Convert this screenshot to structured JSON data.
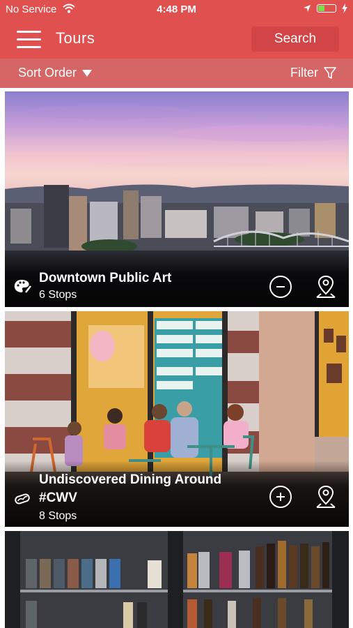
{
  "status": {
    "carrier": "No Service",
    "time": "4:48 PM"
  },
  "nav": {
    "title": "Tours",
    "search_label": "Search"
  },
  "filterbar": {
    "sort_label": "Sort Order",
    "filter_label": "Filter"
  },
  "tours": [
    {
      "title": "Downtown Public Art",
      "stops": "6 Stops",
      "icon": "palette-icon",
      "action": "remove"
    },
    {
      "title_line1": "Undiscovered Dining Around",
      "title_line2": "#CWV",
      "stops": "8 Stops",
      "icon": "hotdog-icon",
      "action": "add"
    },
    {
      "title": "",
      "stops": "",
      "icon": "",
      "action": ""
    }
  ],
  "colors": {
    "brand_red": "#e0504f",
    "filter_bar": "#d66565",
    "search_button": "#d24546"
  }
}
